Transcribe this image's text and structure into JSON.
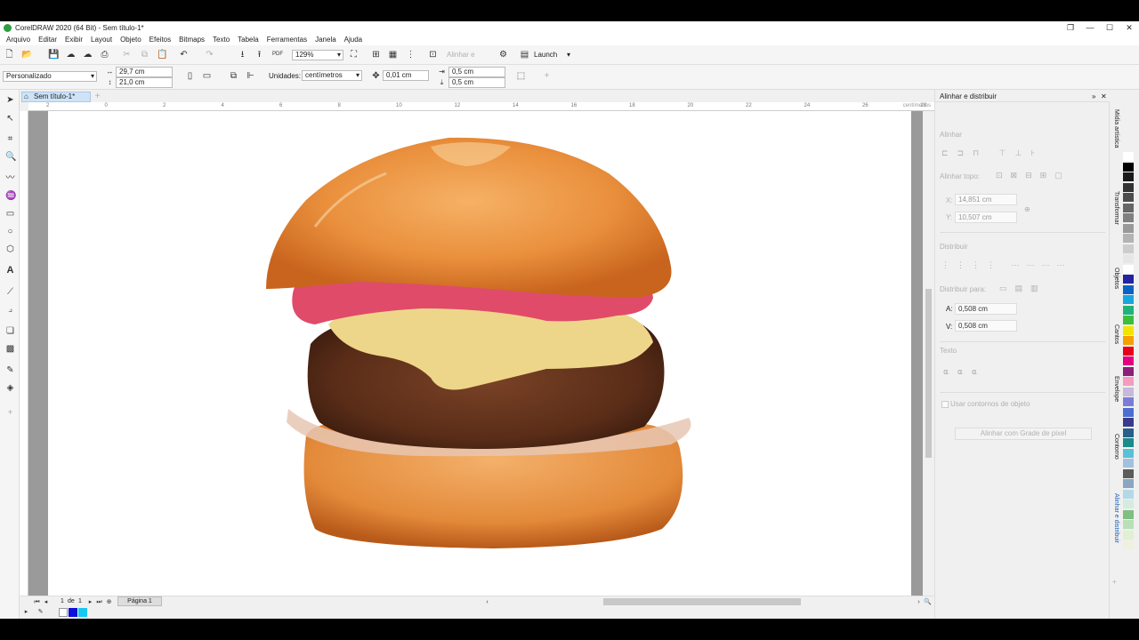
{
  "titlebar": {
    "title": "CorelDRAW 2020 (64 Bit) - Sem título-1*"
  },
  "menu": [
    "Arquivo",
    "Editar",
    "Exibir",
    "Layout",
    "Objeto",
    "Efeitos",
    "Bitmaps",
    "Texto",
    "Tabela",
    "Ferramentas",
    "Janela",
    "Ajuda"
  ],
  "toolbar": {
    "zoom": "129%",
    "align_label": "Alinhar e",
    "launch_label": "Launch"
  },
  "propbar": {
    "preset": "Personalizado",
    "width": "29,7 cm",
    "height": "21,0 cm",
    "units_label": "Unidades:",
    "units_value": "centímetros",
    "nudge": "0,01 cm",
    "dup_x": "0,5 cm",
    "dup_y": "0,5 cm"
  },
  "document": {
    "tab": "Sem título-1*",
    "ruler_unit": "centímetros"
  },
  "ruler_ticks": [
    "2",
    "0",
    "2",
    "4",
    "6",
    "8",
    "10",
    "12",
    "14",
    "16",
    "18",
    "20",
    "22",
    "24",
    "26",
    "28"
  ],
  "pager": {
    "index": "1",
    "of_label": "de",
    "total": "1",
    "page_tab": "Página 1"
  },
  "docker": {
    "title": "Alinhar e distribuir",
    "align_heading": "Alinhar",
    "align_to_label": "Alinhar topo:",
    "x_label": "X:",
    "x_value": "14,851 cm",
    "y_label": "Y:",
    "y_value": "10,507 cm",
    "distribute_heading": "Distribuir",
    "distribute_to_label": "Distribuir para:",
    "h_label": "A:",
    "h_value": "0,508 cm",
    "v_label": "V:",
    "v_value": "0,508 cm",
    "text_heading": "Texto",
    "outline_checkbox": "Usar contornos de objeto",
    "pixel_grid_button": "Alinhar com Grade de pixel"
  },
  "docker_tabs": [
    "Mídia artística",
    "Transformar",
    "Objetos",
    "Cantos",
    "Envelope",
    "Contorno",
    "Alinhar e distribuir"
  ],
  "palette_colors": [
    "#ffffff",
    "#000000",
    "#1a1a1a",
    "#333333",
    "#4d4d4d",
    "#666666",
    "#808080",
    "#999999",
    "#b3b3b3",
    "#cccccc",
    "#e6e6e6",
    "#ffffff",
    "#2323a3",
    "#0a62c4",
    "#18a5e0",
    "#1fb37a",
    "#3bbf3b",
    "#f2e400",
    "#f5a000",
    "#e8001c",
    "#e6007e",
    "#8e1f78",
    "#f59bc0",
    "#c7b8dd",
    "#7c7cd6",
    "#4a6fd1",
    "#3a3a8c",
    "#2b5e8a",
    "#1a8a8a",
    "#59c1d6",
    "#a3c0e0",
    "#5c5c5c",
    "#8aa6c1",
    "#b3d9e8",
    "#d6ebe0",
    "#7fbf7f",
    "#b8e0b8",
    "#e0f0d0",
    "#f0f0e0"
  ]
}
